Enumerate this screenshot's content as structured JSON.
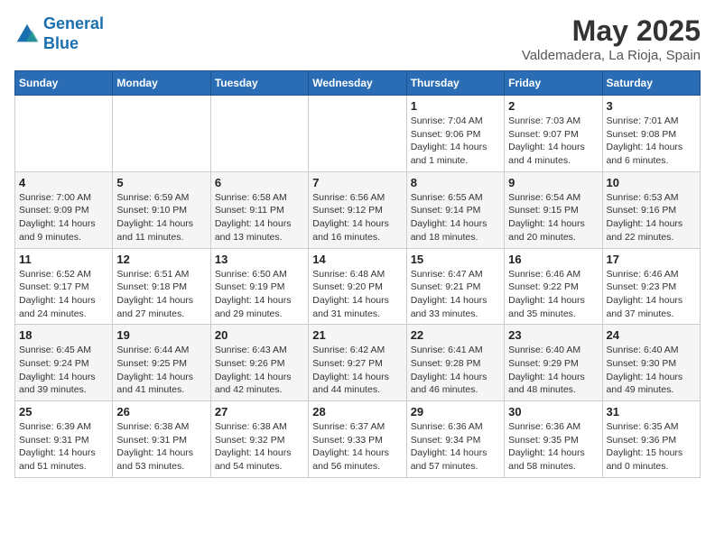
{
  "header": {
    "logo_line1": "General",
    "logo_line2": "Blue",
    "month": "May 2025",
    "location": "Valdemadera, La Rioja, Spain"
  },
  "weekdays": [
    "Sunday",
    "Monday",
    "Tuesday",
    "Wednesday",
    "Thursday",
    "Friday",
    "Saturday"
  ],
  "weeks": [
    [
      {
        "day": "",
        "info": ""
      },
      {
        "day": "",
        "info": ""
      },
      {
        "day": "",
        "info": ""
      },
      {
        "day": "",
        "info": ""
      },
      {
        "day": "1",
        "info": "Sunrise: 7:04 AM\nSunset: 9:06 PM\nDaylight: 14 hours and 1 minute."
      },
      {
        "day": "2",
        "info": "Sunrise: 7:03 AM\nSunset: 9:07 PM\nDaylight: 14 hours and 4 minutes."
      },
      {
        "day": "3",
        "info": "Sunrise: 7:01 AM\nSunset: 9:08 PM\nDaylight: 14 hours and 6 minutes."
      }
    ],
    [
      {
        "day": "4",
        "info": "Sunrise: 7:00 AM\nSunset: 9:09 PM\nDaylight: 14 hours and 9 minutes."
      },
      {
        "day": "5",
        "info": "Sunrise: 6:59 AM\nSunset: 9:10 PM\nDaylight: 14 hours and 11 minutes."
      },
      {
        "day": "6",
        "info": "Sunrise: 6:58 AM\nSunset: 9:11 PM\nDaylight: 14 hours and 13 minutes."
      },
      {
        "day": "7",
        "info": "Sunrise: 6:56 AM\nSunset: 9:12 PM\nDaylight: 14 hours and 16 minutes."
      },
      {
        "day": "8",
        "info": "Sunrise: 6:55 AM\nSunset: 9:14 PM\nDaylight: 14 hours and 18 minutes."
      },
      {
        "day": "9",
        "info": "Sunrise: 6:54 AM\nSunset: 9:15 PM\nDaylight: 14 hours and 20 minutes."
      },
      {
        "day": "10",
        "info": "Sunrise: 6:53 AM\nSunset: 9:16 PM\nDaylight: 14 hours and 22 minutes."
      }
    ],
    [
      {
        "day": "11",
        "info": "Sunrise: 6:52 AM\nSunset: 9:17 PM\nDaylight: 14 hours and 24 minutes."
      },
      {
        "day": "12",
        "info": "Sunrise: 6:51 AM\nSunset: 9:18 PM\nDaylight: 14 hours and 27 minutes."
      },
      {
        "day": "13",
        "info": "Sunrise: 6:50 AM\nSunset: 9:19 PM\nDaylight: 14 hours and 29 minutes."
      },
      {
        "day": "14",
        "info": "Sunrise: 6:48 AM\nSunset: 9:20 PM\nDaylight: 14 hours and 31 minutes."
      },
      {
        "day": "15",
        "info": "Sunrise: 6:47 AM\nSunset: 9:21 PM\nDaylight: 14 hours and 33 minutes."
      },
      {
        "day": "16",
        "info": "Sunrise: 6:46 AM\nSunset: 9:22 PM\nDaylight: 14 hours and 35 minutes."
      },
      {
        "day": "17",
        "info": "Sunrise: 6:46 AM\nSunset: 9:23 PM\nDaylight: 14 hours and 37 minutes."
      }
    ],
    [
      {
        "day": "18",
        "info": "Sunrise: 6:45 AM\nSunset: 9:24 PM\nDaylight: 14 hours and 39 minutes."
      },
      {
        "day": "19",
        "info": "Sunrise: 6:44 AM\nSunset: 9:25 PM\nDaylight: 14 hours and 41 minutes."
      },
      {
        "day": "20",
        "info": "Sunrise: 6:43 AM\nSunset: 9:26 PM\nDaylight: 14 hours and 42 minutes."
      },
      {
        "day": "21",
        "info": "Sunrise: 6:42 AM\nSunset: 9:27 PM\nDaylight: 14 hours and 44 minutes."
      },
      {
        "day": "22",
        "info": "Sunrise: 6:41 AM\nSunset: 9:28 PM\nDaylight: 14 hours and 46 minutes."
      },
      {
        "day": "23",
        "info": "Sunrise: 6:40 AM\nSunset: 9:29 PM\nDaylight: 14 hours and 48 minutes."
      },
      {
        "day": "24",
        "info": "Sunrise: 6:40 AM\nSunset: 9:30 PM\nDaylight: 14 hours and 49 minutes."
      }
    ],
    [
      {
        "day": "25",
        "info": "Sunrise: 6:39 AM\nSunset: 9:31 PM\nDaylight: 14 hours and 51 minutes."
      },
      {
        "day": "26",
        "info": "Sunrise: 6:38 AM\nSunset: 9:31 PM\nDaylight: 14 hours and 53 minutes."
      },
      {
        "day": "27",
        "info": "Sunrise: 6:38 AM\nSunset: 9:32 PM\nDaylight: 14 hours and 54 minutes."
      },
      {
        "day": "28",
        "info": "Sunrise: 6:37 AM\nSunset: 9:33 PM\nDaylight: 14 hours and 56 minutes."
      },
      {
        "day": "29",
        "info": "Sunrise: 6:36 AM\nSunset: 9:34 PM\nDaylight: 14 hours and 57 minutes."
      },
      {
        "day": "30",
        "info": "Sunrise: 6:36 AM\nSunset: 9:35 PM\nDaylight: 14 hours and 58 minutes."
      },
      {
        "day": "31",
        "info": "Sunrise: 6:35 AM\nSunset: 9:36 PM\nDaylight: 15 hours and 0 minutes."
      }
    ]
  ]
}
